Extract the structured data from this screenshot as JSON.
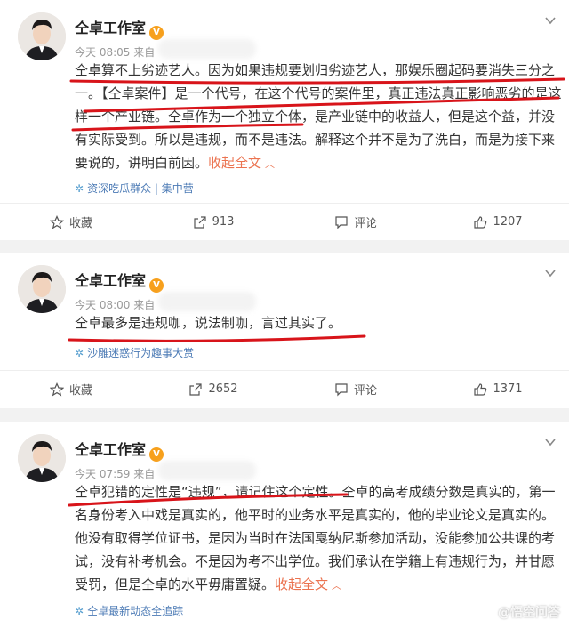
{
  "posts": [
    {
      "author": "仝卓工作室",
      "timestamp": "今天 08:05",
      "via": "来自",
      "body_before": "仝卓算不上劣迹艺人。因为如果违规要划归劣迹艺人，那娱乐圈起码要消失三分之一。【仝卓案件】是一个代号，在这个代号的案件里，真正违法真正影响恶劣的是这样一个产业链。仝卓作为一个独立个体，是产业链中的收益人，但是这个益，并没有实际受到。所以是违规，而不是违法。解释这个并不是为了洗白，而是为接下来要说的，讲明白前因。",
      "expand": "收起全文",
      "source": "资深吃瓜群众 | 集中营",
      "actions": {
        "fav": "收藏",
        "repost": "913",
        "comment": "评论",
        "like": "1207"
      }
    },
    {
      "author": "仝卓工作室",
      "timestamp": "今天 08:00",
      "via": "来自",
      "body_before": "仝卓最多是违规咖，说法制咖，言过其实了。",
      "source": "沙雕迷惑行为趣事大赏",
      "actions": {
        "fav": "收藏",
        "repost": "2652",
        "comment": "评论",
        "like": "1371"
      }
    },
    {
      "author": "仝卓工作室",
      "timestamp": "今天 07:59",
      "via": "来自",
      "body_before": "仝卓犯错的定性是“违规”，请记住这个定性。仝卓的高考成绩分数是真实的，第一名身份考入中戏是真实的，他平时的业务水平是真实的，他的毕业论文是真实的。他没有取得学位证书，是因为当时在法国戛纳尼斯参加活动，没能参加公共课的考试，没有补考机会。不是因为考不出学位。我们承认在学籍上有违规行为，并甘愿受罚，但是仝卓的水平毋庸置疑。",
      "expand": "收起全文",
      "source": "仝卓最新动态全追踪"
    }
  ],
  "watermark": "@悟空问答",
  "colors": {
    "accent": "#eb7350",
    "underline": "#d8141a",
    "link": "#4b7ab5",
    "bg": "#f2f2f2"
  }
}
